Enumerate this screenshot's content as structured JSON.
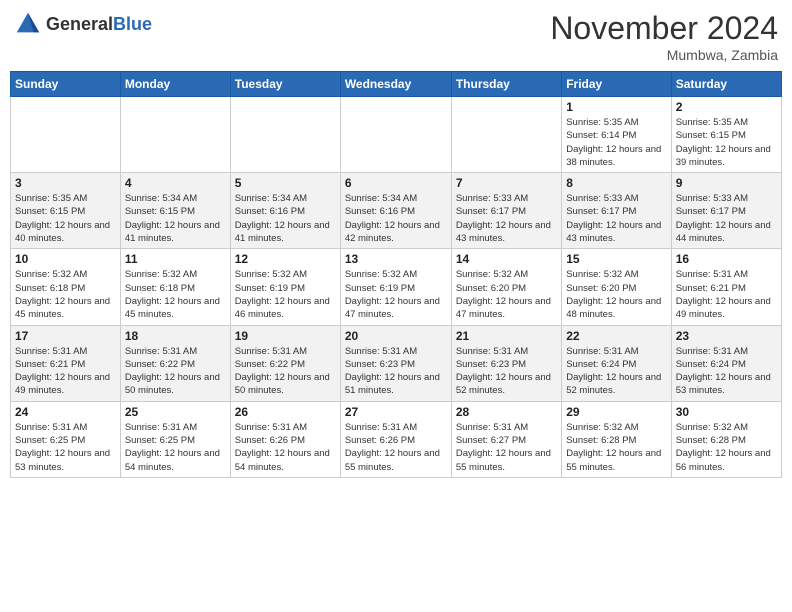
{
  "header": {
    "logo_general": "General",
    "logo_blue": "Blue",
    "month_title": "November 2024",
    "location": "Mumbwa, Zambia"
  },
  "weekdays": [
    "Sunday",
    "Monday",
    "Tuesday",
    "Wednesday",
    "Thursday",
    "Friday",
    "Saturday"
  ],
  "weeks": [
    [
      {
        "day": "",
        "info": ""
      },
      {
        "day": "",
        "info": ""
      },
      {
        "day": "",
        "info": ""
      },
      {
        "day": "",
        "info": ""
      },
      {
        "day": "",
        "info": ""
      },
      {
        "day": "1",
        "info": "Sunrise: 5:35 AM\nSunset: 6:14 PM\nDaylight: 12 hours\nand 38 minutes."
      },
      {
        "day": "2",
        "info": "Sunrise: 5:35 AM\nSunset: 6:15 PM\nDaylight: 12 hours\nand 39 minutes."
      }
    ],
    [
      {
        "day": "3",
        "info": "Sunrise: 5:35 AM\nSunset: 6:15 PM\nDaylight: 12 hours\nand 40 minutes."
      },
      {
        "day": "4",
        "info": "Sunrise: 5:34 AM\nSunset: 6:15 PM\nDaylight: 12 hours\nand 41 minutes."
      },
      {
        "day": "5",
        "info": "Sunrise: 5:34 AM\nSunset: 6:16 PM\nDaylight: 12 hours\nand 41 minutes."
      },
      {
        "day": "6",
        "info": "Sunrise: 5:34 AM\nSunset: 6:16 PM\nDaylight: 12 hours\nand 42 minutes."
      },
      {
        "day": "7",
        "info": "Sunrise: 5:33 AM\nSunset: 6:17 PM\nDaylight: 12 hours\nand 43 minutes."
      },
      {
        "day": "8",
        "info": "Sunrise: 5:33 AM\nSunset: 6:17 PM\nDaylight: 12 hours\nand 43 minutes."
      },
      {
        "day": "9",
        "info": "Sunrise: 5:33 AM\nSunset: 6:17 PM\nDaylight: 12 hours\nand 44 minutes."
      }
    ],
    [
      {
        "day": "10",
        "info": "Sunrise: 5:32 AM\nSunset: 6:18 PM\nDaylight: 12 hours\nand 45 minutes."
      },
      {
        "day": "11",
        "info": "Sunrise: 5:32 AM\nSunset: 6:18 PM\nDaylight: 12 hours\nand 45 minutes."
      },
      {
        "day": "12",
        "info": "Sunrise: 5:32 AM\nSunset: 6:19 PM\nDaylight: 12 hours\nand 46 minutes."
      },
      {
        "day": "13",
        "info": "Sunrise: 5:32 AM\nSunset: 6:19 PM\nDaylight: 12 hours\nand 47 minutes."
      },
      {
        "day": "14",
        "info": "Sunrise: 5:32 AM\nSunset: 6:20 PM\nDaylight: 12 hours\nand 47 minutes."
      },
      {
        "day": "15",
        "info": "Sunrise: 5:32 AM\nSunset: 6:20 PM\nDaylight: 12 hours\nand 48 minutes."
      },
      {
        "day": "16",
        "info": "Sunrise: 5:31 AM\nSunset: 6:21 PM\nDaylight: 12 hours\nand 49 minutes."
      }
    ],
    [
      {
        "day": "17",
        "info": "Sunrise: 5:31 AM\nSunset: 6:21 PM\nDaylight: 12 hours\nand 49 minutes."
      },
      {
        "day": "18",
        "info": "Sunrise: 5:31 AM\nSunset: 6:22 PM\nDaylight: 12 hours\nand 50 minutes."
      },
      {
        "day": "19",
        "info": "Sunrise: 5:31 AM\nSunset: 6:22 PM\nDaylight: 12 hours\nand 50 minutes."
      },
      {
        "day": "20",
        "info": "Sunrise: 5:31 AM\nSunset: 6:23 PM\nDaylight: 12 hours\nand 51 minutes."
      },
      {
        "day": "21",
        "info": "Sunrise: 5:31 AM\nSunset: 6:23 PM\nDaylight: 12 hours\nand 52 minutes."
      },
      {
        "day": "22",
        "info": "Sunrise: 5:31 AM\nSunset: 6:24 PM\nDaylight: 12 hours\nand 52 minutes."
      },
      {
        "day": "23",
        "info": "Sunrise: 5:31 AM\nSunset: 6:24 PM\nDaylight: 12 hours\nand 53 minutes."
      }
    ],
    [
      {
        "day": "24",
        "info": "Sunrise: 5:31 AM\nSunset: 6:25 PM\nDaylight: 12 hours\nand 53 minutes."
      },
      {
        "day": "25",
        "info": "Sunrise: 5:31 AM\nSunset: 6:25 PM\nDaylight: 12 hours\nand 54 minutes."
      },
      {
        "day": "26",
        "info": "Sunrise: 5:31 AM\nSunset: 6:26 PM\nDaylight: 12 hours\nand 54 minutes."
      },
      {
        "day": "27",
        "info": "Sunrise: 5:31 AM\nSunset: 6:26 PM\nDaylight: 12 hours\nand 55 minutes."
      },
      {
        "day": "28",
        "info": "Sunrise: 5:31 AM\nSunset: 6:27 PM\nDaylight: 12 hours\nand 55 minutes."
      },
      {
        "day": "29",
        "info": "Sunrise: 5:32 AM\nSunset: 6:28 PM\nDaylight: 12 hours\nand 55 minutes."
      },
      {
        "day": "30",
        "info": "Sunrise: 5:32 AM\nSunset: 6:28 PM\nDaylight: 12 hours\nand 56 minutes."
      }
    ]
  ]
}
